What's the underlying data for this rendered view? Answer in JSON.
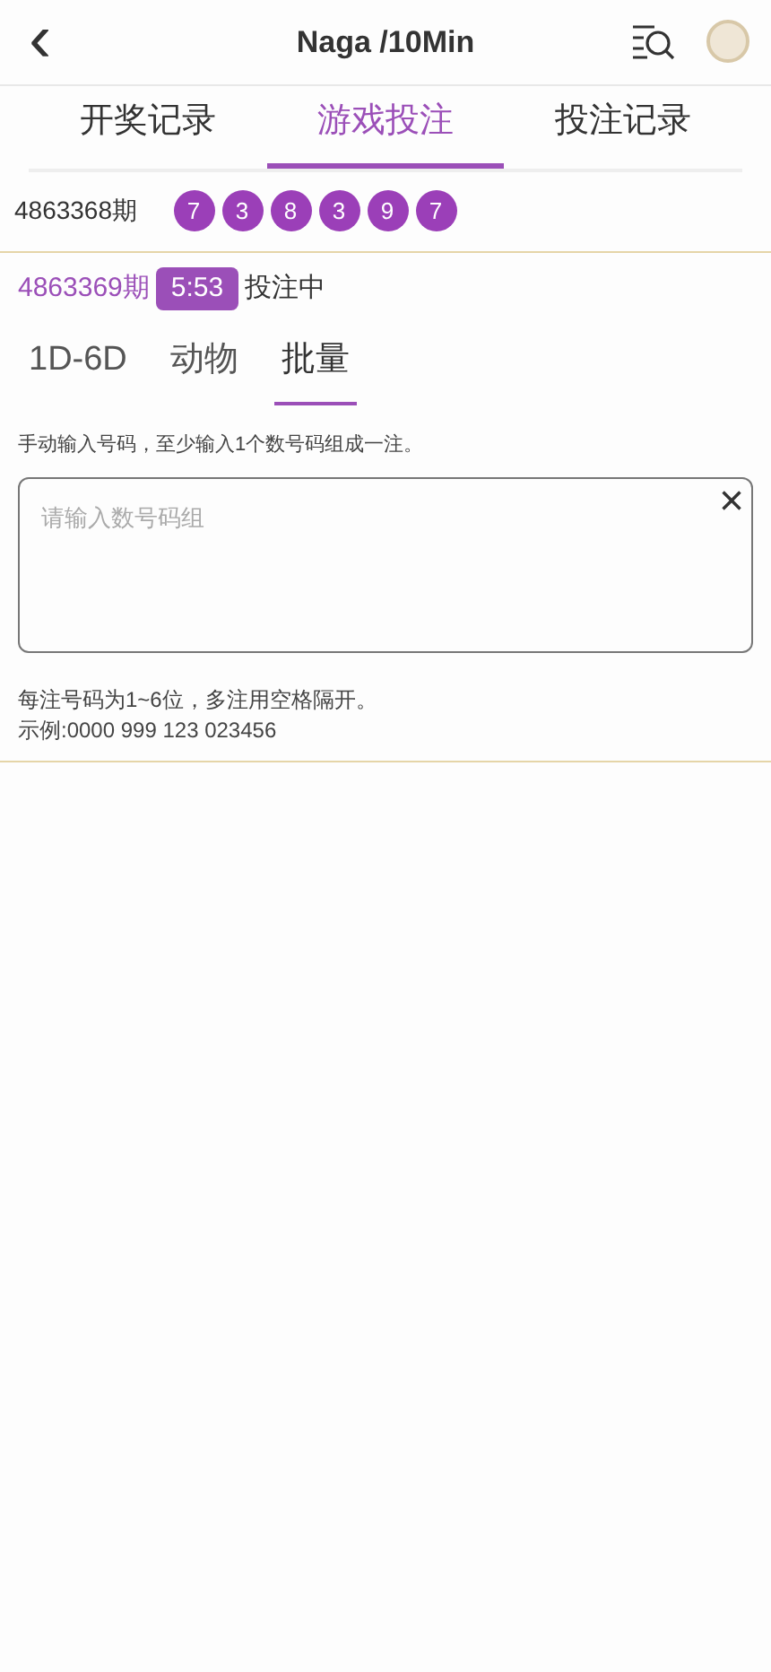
{
  "header": {
    "back": "‹",
    "title": "Naga /10Min"
  },
  "tabs": [
    {
      "label": "开奖记录",
      "selected": false
    },
    {
      "label": "游戏投注",
      "selected": true
    },
    {
      "label": "投注记录",
      "selected": false
    }
  ],
  "last_draw": {
    "period": "4863368期",
    "balls": [
      "7",
      "3",
      "8",
      "3",
      "9",
      "7"
    ]
  },
  "current": {
    "period": "4863369期",
    "countdown": "5:53",
    "status": "投注中"
  },
  "subtabs": [
    {
      "label": "1D-6D",
      "selected": false
    },
    {
      "label": "动物",
      "selected": false
    },
    {
      "label": "批量",
      "selected": true
    }
  ],
  "hint": "手动输入号码，至少输入1个数号码组成一注。",
  "input": {
    "placeholder": "请输入数号码组",
    "clear": "×"
  },
  "notes": [
    "每注号码为1~6位，多注用空格隔开。",
    "示例:0000 999 123 023456"
  ]
}
